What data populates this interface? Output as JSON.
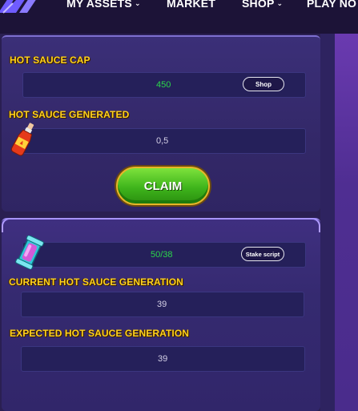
{
  "nav": {
    "items": [
      {
        "label": "MY ASSETS",
        "has_dropdown": true
      },
      {
        "label": "MARKET",
        "has_dropdown": false
      },
      {
        "label": "SHOP",
        "has_dropdown": true
      },
      {
        "label": "PLAY NO",
        "has_dropdown": false
      }
    ]
  },
  "panel_top": {
    "cap_label": "HOT SAUCE CAP",
    "cap_value": "450",
    "shop_button": "Shop",
    "generated_label": "HOT SAUCE GENERATED",
    "generated_value": "0,5",
    "claim_button": "CLAIM"
  },
  "panel_bottom": {
    "stake_value": "50/38",
    "stake_button": "Stake script",
    "current_label": "CURRENT HOT SAUCE GENERATION",
    "current_value": "39",
    "expected_label": "EXPECTED HOT SAUCE GENERATION",
    "expected_value": "39"
  },
  "colors": {
    "label_yellow": "#ffd21f",
    "value_green": "#2bd64a",
    "claim_green": "#3fb51c",
    "panel_purple": "#3b2f78"
  },
  "icons": [
    "logo-icon",
    "chevron-down-icon",
    "hot-sauce-bottle-icon",
    "script-capsule-icon"
  ]
}
